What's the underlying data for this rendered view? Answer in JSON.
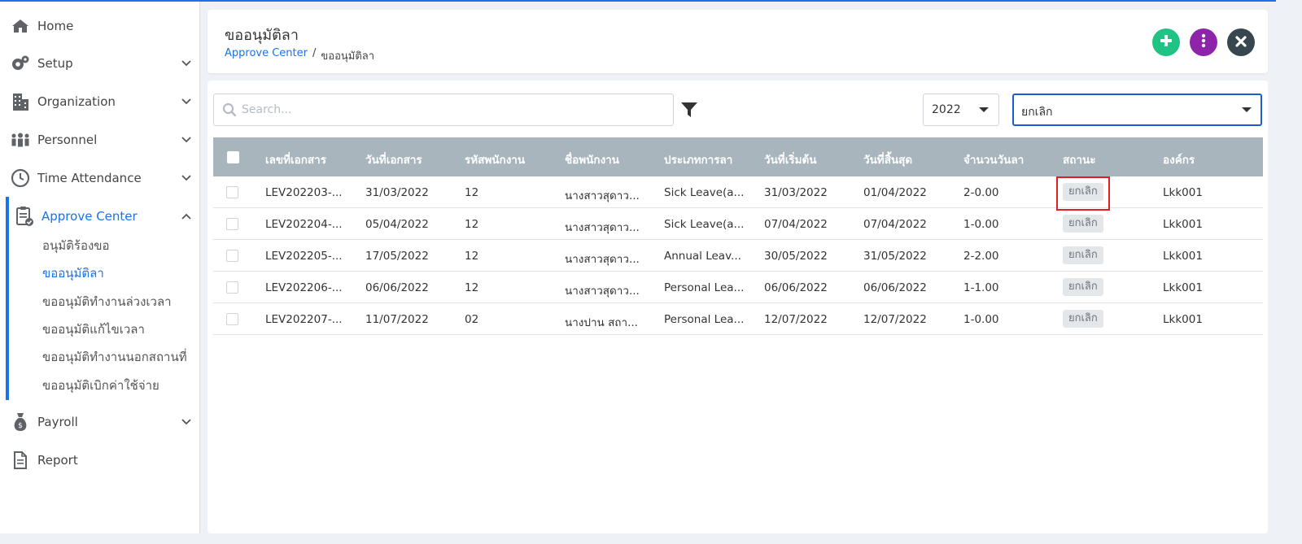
{
  "sidebar": {
    "items": [
      {
        "label": "Home",
        "icon": "home-icon"
      },
      {
        "label": "Setup",
        "icon": "gears-icon"
      },
      {
        "label": "Organization",
        "icon": "building-icon"
      },
      {
        "label": "Personnel",
        "icon": "users-icon"
      },
      {
        "label": "Time Attendance",
        "icon": "clock-icon"
      },
      {
        "label": "Approve Center",
        "icon": "clipboard-check-icon",
        "active": true
      },
      {
        "label": "Payroll",
        "icon": "money-bag-icon"
      },
      {
        "label": "Report",
        "icon": "file-icon"
      }
    ],
    "subitems": [
      {
        "label": "อนุมัติร้องขอ"
      },
      {
        "label": "ขออนุมัติลา",
        "active": true
      },
      {
        "label": "ขออนุมัติทำงานล่วงเวลา"
      },
      {
        "label": "ขออนุมัติแก้ไขเวลา"
      },
      {
        "label": "ขออนุมัติทำงานนอกสถานที่"
      },
      {
        "label": "ขออนุมัติเบิกค่าใช้จ่าย"
      }
    ]
  },
  "header": {
    "title": "ขออนุมัติลา",
    "breadcrumb": {
      "link": "Approve Center",
      "separator": "/",
      "current": "ขออนุมัติลา"
    },
    "buttons": [
      {
        "name": "add",
        "color": "#20c384"
      },
      {
        "name": "more",
        "color": "#8e24aa"
      },
      {
        "name": "close",
        "color": "#37474f"
      }
    ]
  },
  "toolbar": {
    "search_placeholder": "Search...",
    "year": "2022",
    "status": "ยกเลิก"
  },
  "table": {
    "columns": [
      "เลขที่เอกสาร",
      "วันที่เอกสาร",
      "รหัสพนักงาน",
      "ชื่อพนักงาน",
      "ประเภทการลา",
      "วันที่เริ่มต้น",
      "วันที่สิ้นสุด",
      "จำนวนวันลา",
      "สถานะ",
      "องค์กร"
    ],
    "rows": [
      {
        "doc_no": "LEV202203-...",
        "doc_date": "31/03/2022",
        "emp_code": "12",
        "emp_name": "นางสาวสุดาว...",
        "leave_type": "Sick Leave(a...",
        "start": "31/03/2022",
        "end": "01/04/2022",
        "days": "2-0.00",
        "status": "ยกเลิก",
        "org": "Lkk001"
      },
      {
        "doc_no": "LEV202204-...",
        "doc_date": "05/04/2022",
        "emp_code": "12",
        "emp_name": "นางสาวสุดาว...",
        "leave_type": "Sick Leave(a...",
        "start": "07/04/2022",
        "end": "07/04/2022",
        "days": "1-0.00",
        "status": "ยกเลิก",
        "org": "Lkk001"
      },
      {
        "doc_no": "LEV202205-...",
        "doc_date": "17/05/2022",
        "emp_code": "12",
        "emp_name": "นางสาวสุดาว...",
        "leave_type": "Annual Leav...",
        "start": "30/05/2022",
        "end": "31/05/2022",
        "days": "2-2.00",
        "status": "ยกเลิก",
        "org": "Lkk001"
      },
      {
        "doc_no": "LEV202206-...",
        "doc_date": "06/06/2022",
        "emp_code": "12",
        "emp_name": "นางสาวสุดาว...",
        "leave_type": "Personal Lea...",
        "start": "06/06/2022",
        "end": "06/06/2022",
        "days": "1-1.00",
        "status": "ยกเลิก",
        "org": "Lkk001"
      },
      {
        "doc_no": "LEV202207-...",
        "doc_date": "11/07/2022",
        "emp_code": "02",
        "emp_name": "นางปาน สถา...",
        "leave_type": "Personal Lea...",
        "start": "12/07/2022",
        "end": "12/07/2022",
        "days": "1-0.00",
        "status": "ยกเลิก",
        "org": "Lkk001"
      }
    ]
  },
  "colors": {
    "accent": "#1a73e8",
    "table_header": "#a9b5bd",
    "highlight": "#e02020"
  }
}
